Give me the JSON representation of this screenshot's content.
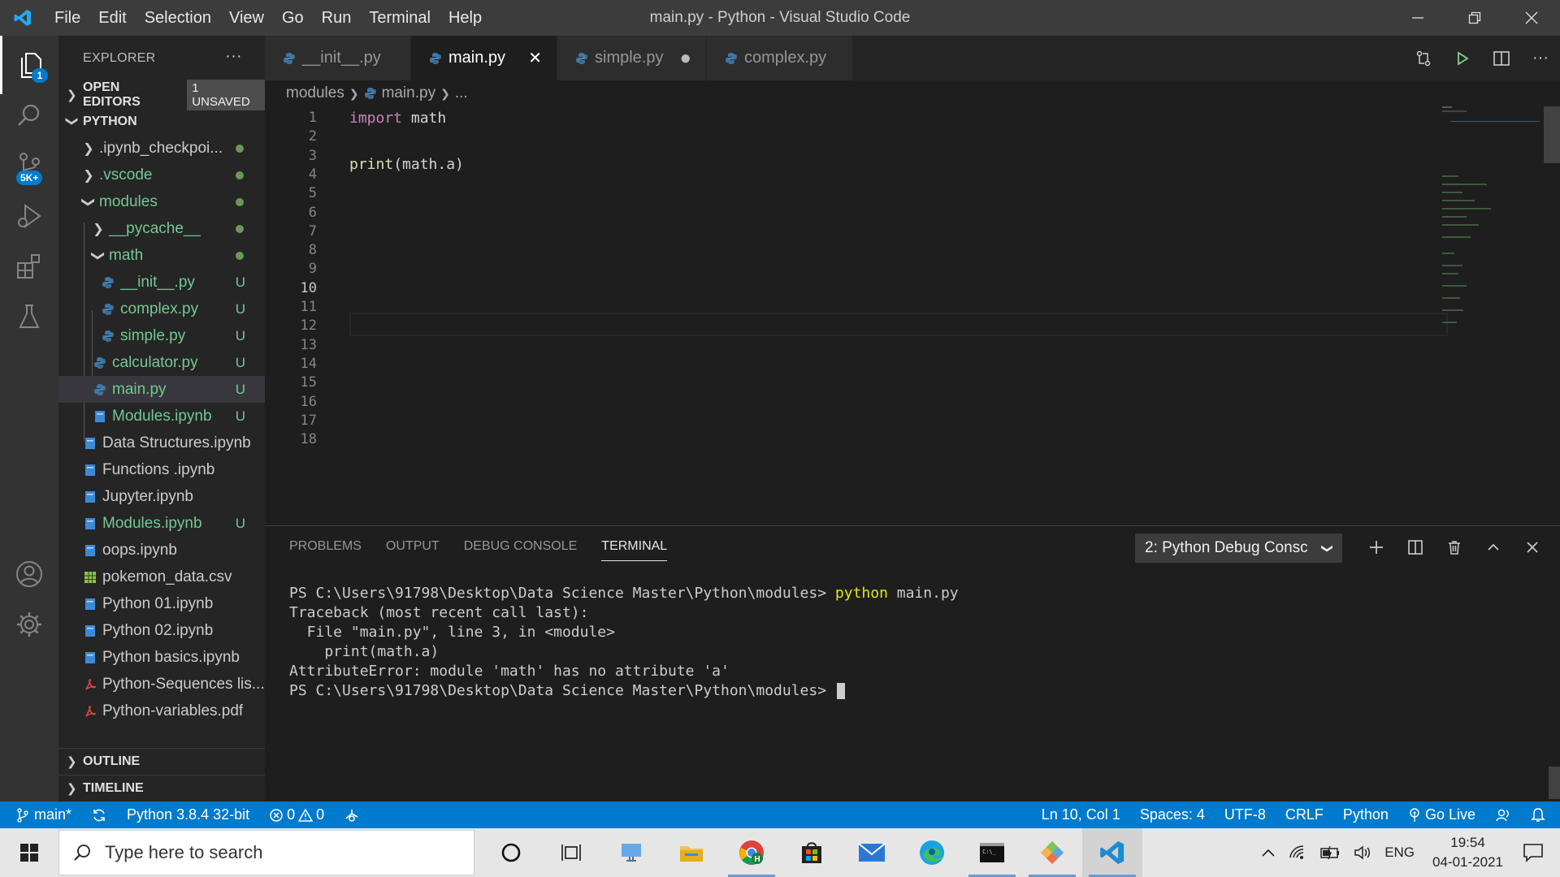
{
  "window": {
    "title": "main.py - Python - Visual Studio Code",
    "menu": [
      "File",
      "Edit",
      "Selection",
      "View",
      "Go",
      "Run",
      "Terminal",
      "Help"
    ]
  },
  "activity": {
    "explorer_badge": "1",
    "scm_badge": "5K+"
  },
  "sidebar": {
    "title": "EXPLORER",
    "open_editors": "OPEN EDITORS",
    "unsaved": "1 UNSAVED",
    "folder": "PYTHON",
    "items": [
      {
        "label": ".ipynb_checkpoi...",
        "deco": ""
      },
      {
        "label": ".vscode",
        "deco": ""
      },
      {
        "label": "modules",
        "deco": ""
      },
      {
        "label": "__pycache__",
        "deco": ""
      },
      {
        "label": "math",
        "deco": ""
      },
      {
        "label": "__init__.py",
        "deco": "U"
      },
      {
        "label": "complex.py",
        "deco": "U"
      },
      {
        "label": "simple.py",
        "deco": "U"
      },
      {
        "label": "calculator.py",
        "deco": "U"
      },
      {
        "label": "main.py",
        "deco": "U"
      },
      {
        "label": "Modules.ipynb",
        "deco": "U"
      },
      {
        "label": "Data Structures.ipynb",
        "deco": ""
      },
      {
        "label": "Functions .ipynb",
        "deco": ""
      },
      {
        "label": "Jupyter.ipynb",
        "deco": ""
      },
      {
        "label": "Modules.ipynb",
        "deco": "U"
      },
      {
        "label": "oops.ipynb",
        "deco": ""
      },
      {
        "label": "pokemon_data.csv",
        "deco": ""
      },
      {
        "label": "Python 01.ipynb",
        "deco": ""
      },
      {
        "label": "Python 02.ipynb",
        "deco": ""
      },
      {
        "label": "Python basics.ipynb",
        "deco": ""
      },
      {
        "label": "Python-Sequences lis...",
        "deco": ""
      },
      {
        "label": "Python-variables.pdf",
        "deco": ""
      }
    ],
    "outline": "OUTLINE",
    "timeline": "TIMELINE"
  },
  "tabs": [
    {
      "label": "__init__.py"
    },
    {
      "label": "main.py"
    },
    {
      "label": "simple.py"
    },
    {
      "label": "complex.py"
    }
  ],
  "breadcrumb": {
    "folder": "modules",
    "file": "main.py",
    "more": "..."
  },
  "editor": {
    "line_numbers": [
      "1",
      "2",
      "3",
      "4",
      "5",
      "6",
      "7",
      "8",
      "9",
      "10",
      "11",
      "12",
      "13",
      "14",
      "15",
      "16",
      "17",
      "18"
    ],
    "current_line": "10",
    "code": {
      "line1_kw": "import",
      "line1_rest": " math",
      "line3_fn": "print",
      "line3_rest": "(math.a)"
    }
  },
  "panel": {
    "tabs": [
      "PROBLEMS",
      "OUTPUT",
      "DEBUG CONSOLE",
      "TERMINAL"
    ],
    "terminal_select": "2: Python Debug Consc",
    "lines": {
      "l1_prompt": "PS C:\\Users\\91798\\Desktop\\Data Science Master\\Python\\modules> ",
      "l1_cmd": "python",
      "l1_arg": " main.py",
      "l2": "Traceback (most recent call last):",
      "l3": "  File \"main.py\", line 3, in <module>",
      "l4": "    print(math.a)",
      "l5": "AttributeError: module 'math' has no attribute 'a'",
      "l6_prompt": "PS C:\\Users\\91798\\Desktop\\Data Science Master\\Python\\modules> "
    }
  },
  "status": {
    "branch": "main*",
    "interpreter": "Python 3.8.4 32-bit",
    "errors": "0",
    "warnings": "0",
    "position": "Ln 10, Col 1",
    "spaces": "Spaces: 4",
    "encoding": "UTF-8",
    "eol": "CRLF",
    "language": "Python",
    "golive": "Go Live"
  },
  "taskbar": {
    "search_placeholder": "Type here to search",
    "language": "ENG",
    "time": "19:54",
    "date": "04-01-2021"
  },
  "colors": {
    "accent": "#007acc",
    "untracked": "#73c991",
    "keyword": "#c586c0",
    "function": "#dcdcaa"
  }
}
